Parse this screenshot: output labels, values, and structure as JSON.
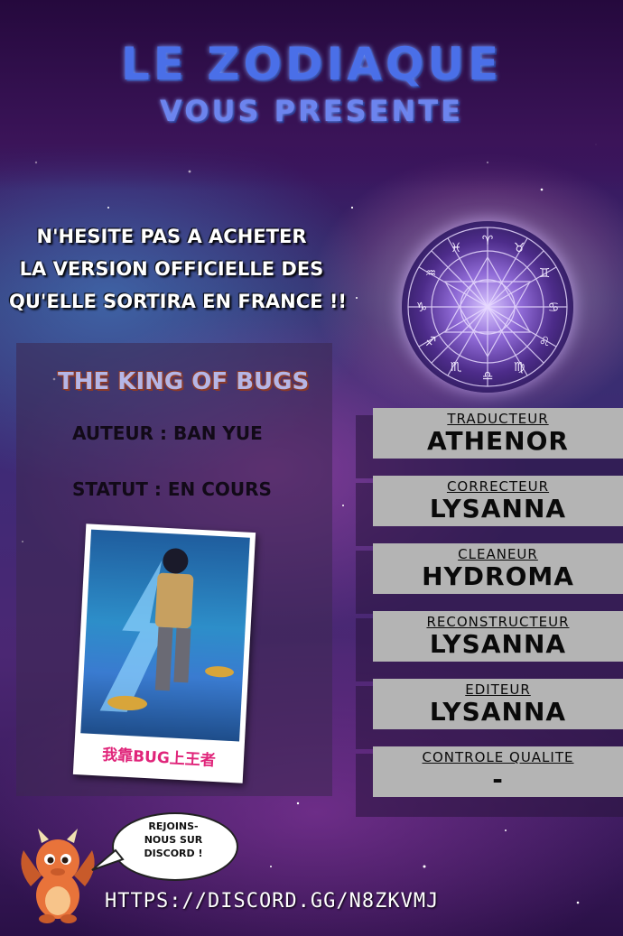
{
  "header": {
    "title": "LE ZODIAQUE",
    "subtitle": "VOUS PRESENTE"
  },
  "notice": {
    "lines": [
      "N'HESITE PAS A ACHETER",
      "LA VERSION OFFICIELLE DES",
      "QU'ELLE SORTIRA EN FRANCE !!"
    ]
  },
  "manga": {
    "title": "THE KING OF BUGS",
    "author_line": "AUTEUR :  BAN YUE",
    "status_line": "STATUT : EN COURS",
    "cover_logo": "我靠BUG上王者"
  },
  "credits": [
    {
      "role": "TRADUCTEUR",
      "name": "ATHENOR"
    },
    {
      "role": "CORRECTEUR",
      "name": "LYSANNA"
    },
    {
      "role": "CLEANEUR",
      "name": "HYDROMA"
    },
    {
      "role": "RECONSTRUCTEUR",
      "name": "LYSANNA"
    },
    {
      "role": "EDITEUR",
      "name": "LYSANNA"
    },
    {
      "role": "CONTROLE QUALITE",
      "name": "-"
    }
  ],
  "discord": {
    "bubble_lines": [
      "REJOINS-",
      "NOUS SUR",
      "DISCORD !"
    ],
    "link": "HTTPS://DISCORD.GG/N8ZKVMJ"
  },
  "colors": {
    "title_blue": "#4a6fe8",
    "credit_bg": "#b4b4b4",
    "mascot_orange": "#e8733a"
  },
  "icons": [
    "zodiac-wheel-icon",
    "dragon-mascot-icon"
  ]
}
